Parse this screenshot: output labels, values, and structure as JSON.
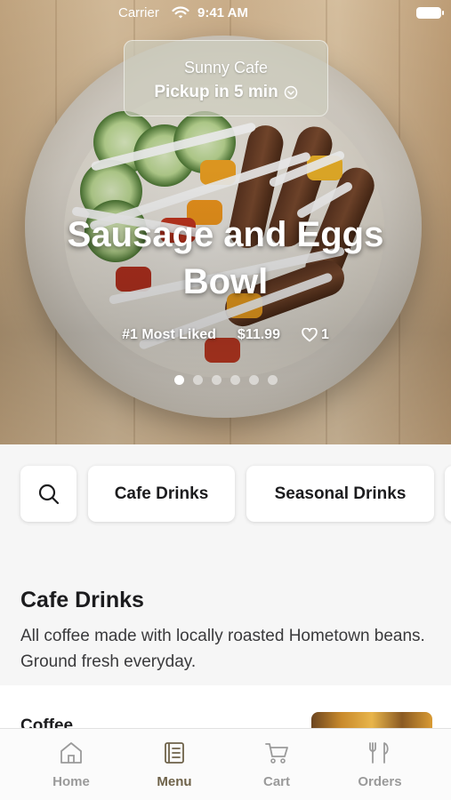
{
  "status_bar": {
    "carrier": "Carrier",
    "time": "9:41 AM"
  },
  "pickup": {
    "store": "Sunny Cafe",
    "eta": "Pickup in 5 min"
  },
  "feature": {
    "title_line1": "Sausage and Eggs",
    "title_line2": "Bowl",
    "badge": "#1 Most Liked",
    "price": "$11.99",
    "likes": "1",
    "slide_count": 6,
    "active_slide": 1
  },
  "categories": {
    "search_icon": "search-icon",
    "chips": [
      "Cafe Drinks",
      "Seasonal Drinks"
    ]
  },
  "section": {
    "title": "Cafe Drinks",
    "description": "All coffee made with locally roasted Hometown beans. Ground fresh everyday."
  },
  "first_item": {
    "name": "Coffee"
  },
  "tabs": [
    {
      "label": "Home",
      "icon": "home-icon",
      "active": false
    },
    {
      "label": "Menu",
      "icon": "menu-icon",
      "active": true
    },
    {
      "label": "Cart",
      "icon": "cart-icon",
      "active": false
    },
    {
      "label": "Orders",
      "icon": "orders-icon",
      "active": false
    }
  ],
  "colors": {
    "active_tab": "#6e6249",
    "inactive_tab": "#9a9a9a",
    "background": "#f6f6f6"
  }
}
